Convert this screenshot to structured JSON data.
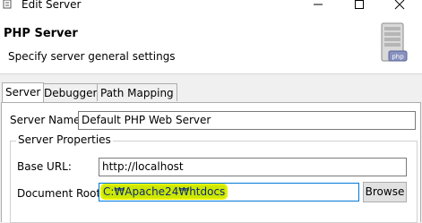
{
  "window": {
    "title": "Edit Server",
    "icon": "app-icon",
    "controls": [
      "minimize-icon",
      "maximize-icon",
      "close-icon"
    ]
  },
  "header": {
    "title": "PHP Server",
    "subtitle": "Specify server general settings",
    "icon": "php-server-icon",
    "icon_label": "php"
  },
  "tabs": [
    {
      "label": "Server",
      "active": true
    },
    {
      "label": "Debugger",
      "active": false
    },
    {
      "label": "Path Mapping",
      "active": false
    }
  ],
  "server_tab": {
    "server_name_label": "Server Name:",
    "server_name_value": "Default PHP Web Server",
    "properties_group_label": "Server Properties",
    "base_url_label": "Base URL:",
    "base_url_value": "http://localhost",
    "document_root_label": "Document Root:",
    "document_root_value": "C:₩Apache24₩htdocs",
    "browse_label": "Browse"
  },
  "colors": {
    "highlight": "#d7f000",
    "focus_border": "#0078d7"
  }
}
